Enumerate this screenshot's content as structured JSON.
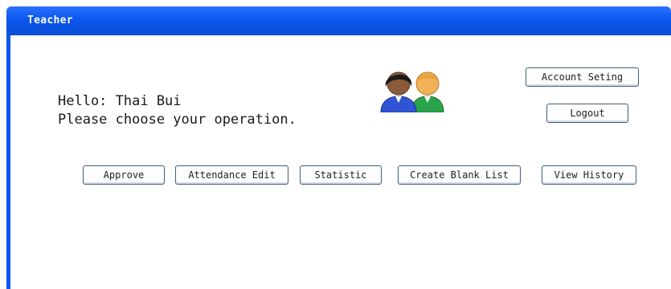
{
  "window": {
    "title": "Teacher"
  },
  "greeting": {
    "hello": "Hello: Thai Bui",
    "prompt": "Please choose your operation."
  },
  "header_buttons": {
    "account_setting": "Account Seting",
    "logout": "Logout"
  },
  "operations": [
    {
      "label": "Approve"
    },
    {
      "label": "Attendance Edit"
    },
    {
      "label": "Statistic"
    },
    {
      "label": "Create Blank List"
    },
    {
      "label": "View History"
    }
  ],
  "icons": {
    "users": "users-icon"
  },
  "colors": {
    "titlebar": "#0b57ee",
    "button_border": "#3f5f7f"
  }
}
